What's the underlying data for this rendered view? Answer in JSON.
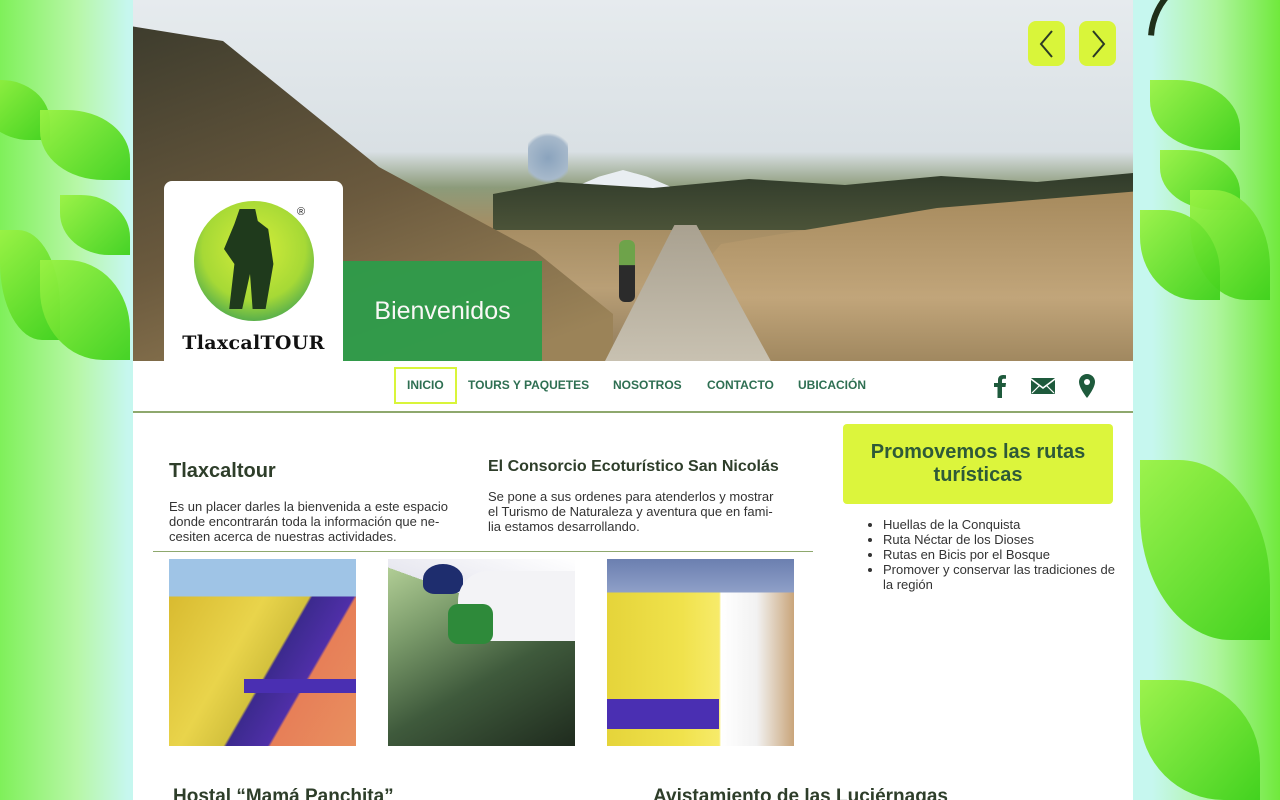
{
  "hero": {
    "welcome": "Bienvenidos",
    "brand": "TlaxcalTOUR",
    "registered": "®"
  },
  "nav": {
    "items": [
      "INICIO",
      "TOURS Y PAQUETES",
      "NOSOTROS",
      "CONTACTO",
      "UBICACIÓN"
    ],
    "active": "INICIO"
  },
  "social_icons": [
    "facebook-icon",
    "mail-icon",
    "location-pin-icon"
  ],
  "intro": {
    "title": "Tlaxcaltour",
    "text": "Es un placer darles la bienvenida a este espacio donde encontrarán toda la información que ne-cesiten acerca de nuestras actividades."
  },
  "consorcio": {
    "title": "El Consorcio Ecoturístico San Nicolás",
    "text": "Se pone a sus ordenes para atenderlos y mostrar el Turismo de Naturaleza y aventura que en fami-lia estamos desarrollando."
  },
  "promo": {
    "title": "Promovemos las rutas turísticas",
    "routes": [
      "Huellas de la Conquista",
      "Ruta Néctar de los Dioses",
      "Rutas en Bicis por el Bosque",
      "Promover y conservar las tradiciones de la región"
    ]
  },
  "sections": {
    "hostal": "Hostal “Mamá Panchita”",
    "luciernagas": "Avistamiento de las Luciérnagas"
  },
  "colors": {
    "accent": "#dcf53c",
    "green": "#2e9c4a",
    "nav_text": "#2e6f52"
  }
}
